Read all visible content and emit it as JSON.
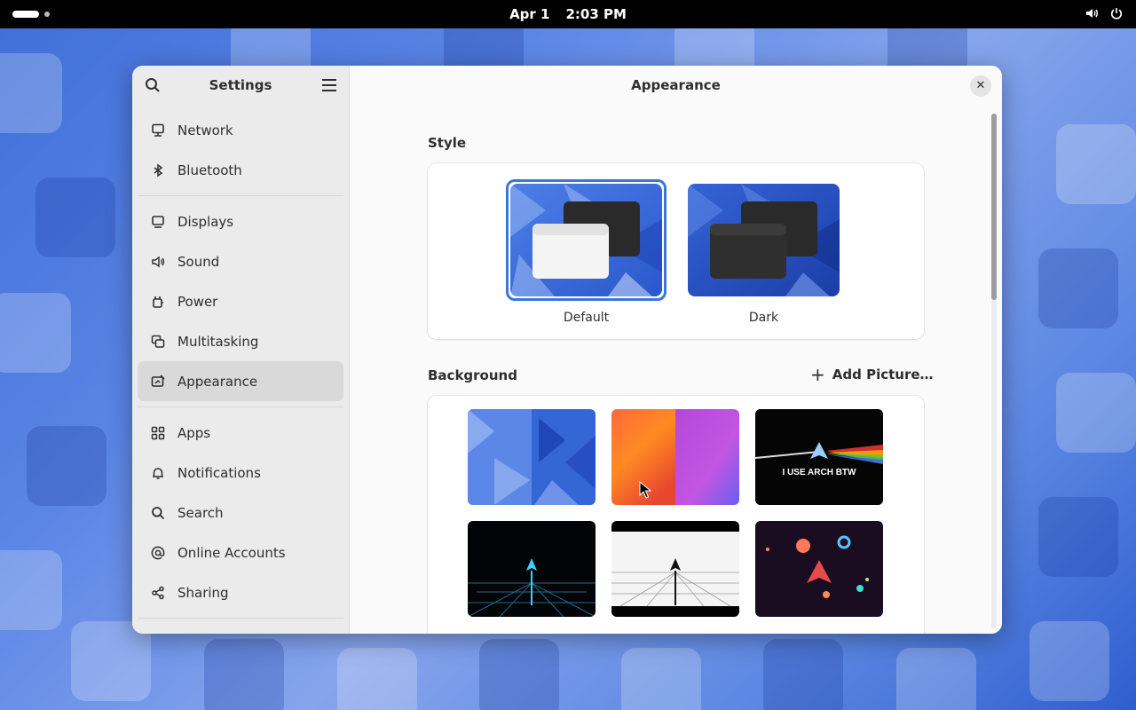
{
  "topbar": {
    "date": "Apr 1",
    "time": "2:03 PM",
    "volume_icon": "speaker-icon",
    "power_icon": "power-icon"
  },
  "sidebar": {
    "title": "Settings",
    "groups": [
      [
        {
          "label": "Network",
          "icon": "network-icon"
        },
        {
          "label": "Bluetooth",
          "icon": "bluetooth-icon"
        }
      ],
      [
        {
          "label": "Displays",
          "icon": "display-icon"
        },
        {
          "label": "Sound",
          "icon": "speaker-icon"
        },
        {
          "label": "Power",
          "icon": "power-plug-icon"
        },
        {
          "label": "Multitasking",
          "icon": "multitasking-icon"
        },
        {
          "label": "Appearance",
          "icon": "appearance-icon",
          "selected": true
        }
      ],
      [
        {
          "label": "Apps",
          "icon": "apps-grid-icon"
        },
        {
          "label": "Notifications",
          "icon": "bell-icon"
        },
        {
          "label": "Search",
          "icon": "search-icon"
        },
        {
          "label": "Online Accounts",
          "icon": "at-sign-icon"
        },
        {
          "label": "Sharing",
          "icon": "share-icon"
        }
      ]
    ]
  },
  "main": {
    "title": "Appearance",
    "style": {
      "heading": "Style",
      "options": [
        {
          "label": "Default",
          "selected": true
        },
        {
          "label": "Dark",
          "selected": false
        }
      ]
    },
    "background": {
      "heading": "Background",
      "add_label": "Add Picture…",
      "wallpapers": [
        {
          "name": "blue-triangles-wallpaper"
        },
        {
          "name": "orange-purple-gradient-wallpaper"
        },
        {
          "name": "arch-prism-wallpaper",
          "text": "I USE ARCH BTW"
        },
        {
          "name": "arch-neon-grid-wallpaper"
        },
        {
          "name": "arch-white-grid-wallpaper"
        },
        {
          "name": "arch-planets-wallpaper"
        }
      ]
    }
  },
  "colors": {
    "accent": "#3a78d8",
    "sidebar_bg": "#ebebeb",
    "selected_item": "#d9d9d9"
  }
}
